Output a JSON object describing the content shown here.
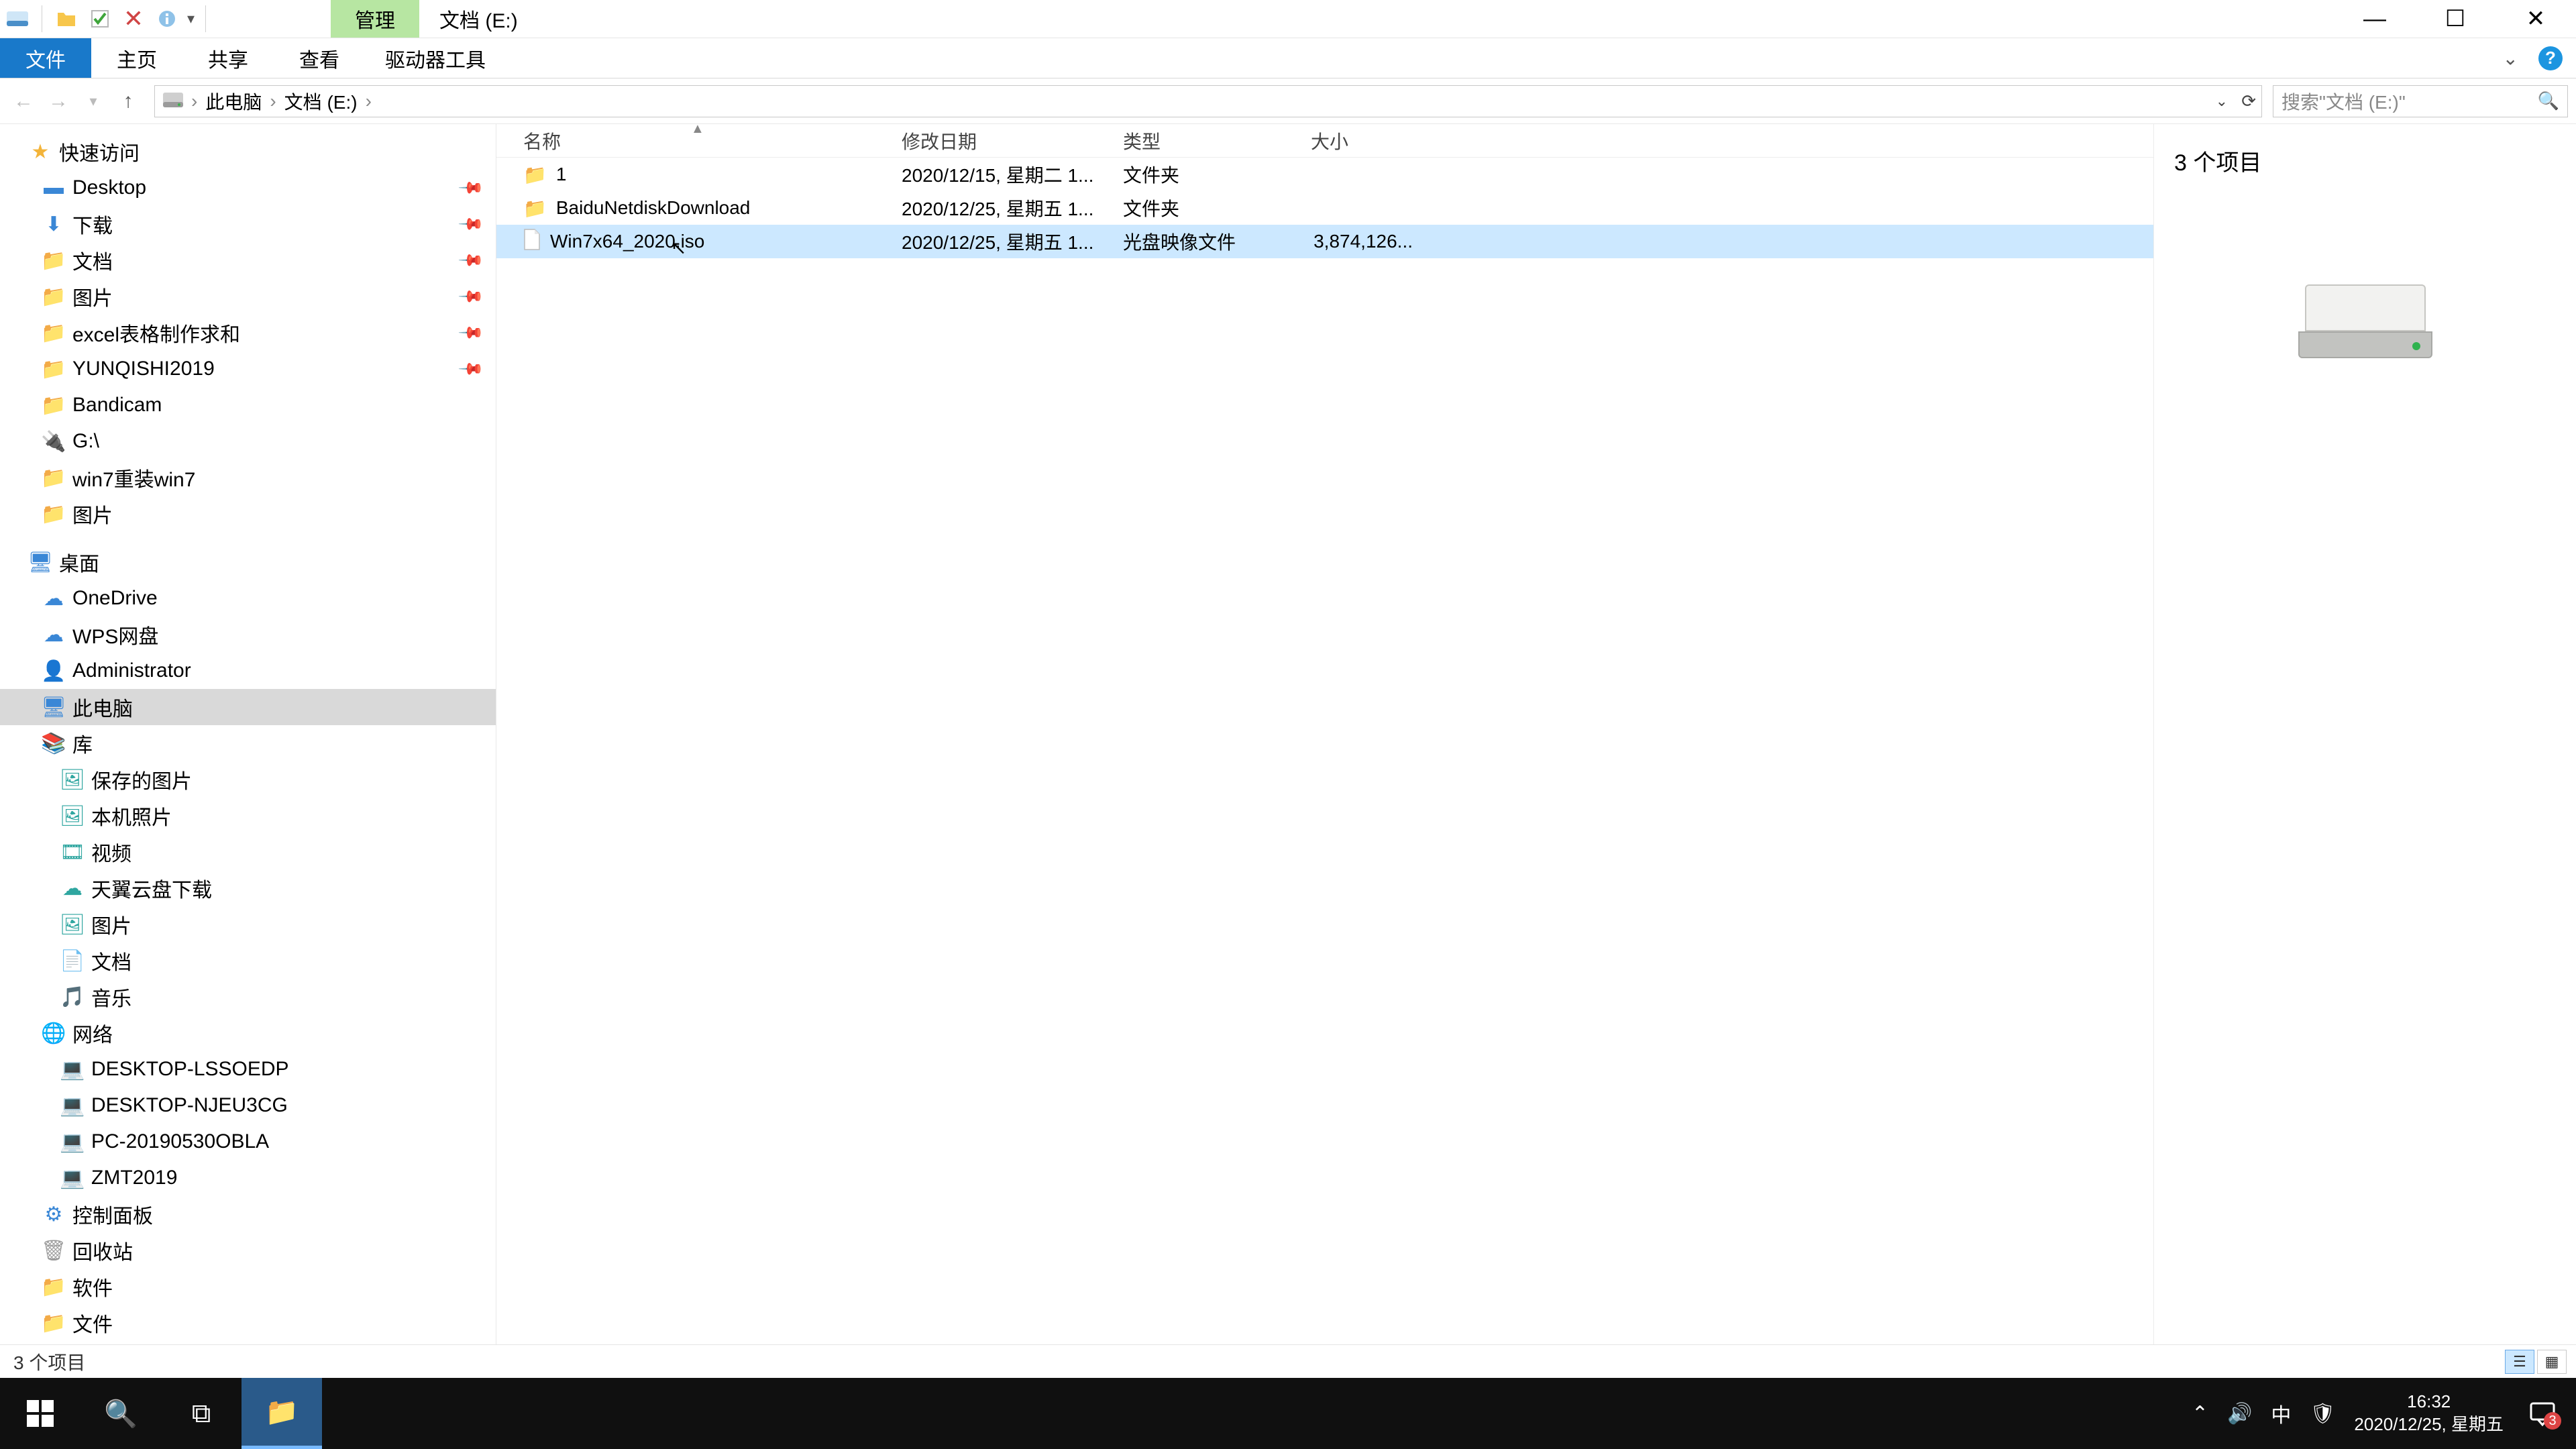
{
  "titlebar": {
    "context_tab": "管理",
    "window_title": "文档 (E:)"
  },
  "ribbon": {
    "file": "文件",
    "home": "主页",
    "share": "共享",
    "view": "查看",
    "drive": "驱动器工具"
  },
  "breadcrumbs": {
    "root": "此电脑",
    "drive": "文档 (E:)"
  },
  "search": {
    "placeholder": "搜索\"文档 (E:)\""
  },
  "tree": {
    "quick_access": "快速访问",
    "desktop": "Desktop",
    "downloads": "下载",
    "documents": "文档",
    "pictures": "图片",
    "excel": "excel表格制作求和",
    "yunqishi": "YUNQISHI2019",
    "bandicam": "Bandicam",
    "gdrive": "G:\\",
    "win7": "win7重装win7",
    "pictures2": "图片",
    "desktop_cn": "桌面",
    "onedrive": "OneDrive",
    "wps": "WPS网盘",
    "admin": "Administrator",
    "this_pc": "此电脑",
    "library": "库",
    "saved_pics": "保存的图片",
    "camera_roll": "本机照片",
    "video": "视频",
    "tianyi": "天翼云盘下载",
    "pictures3": "图片",
    "documents2": "文档",
    "music": "音乐",
    "network": "网络",
    "pc1": "DESKTOP-LSSOEDP",
    "pc2": "DESKTOP-NJEU3CG",
    "pc3": "PC-20190530OBLA",
    "pc4": "ZMT2019",
    "control": "控制面板",
    "recycle": "回收站",
    "software": "软件",
    "files": "文件"
  },
  "columns": {
    "name": "名称",
    "date": "修改日期",
    "type": "类型",
    "size": "大小"
  },
  "rows": [
    {
      "name": "1",
      "date": "2020/12/15, 星期二 1...",
      "type": "文件夹",
      "size": ""
    },
    {
      "name": "BaiduNetdiskDownload",
      "date": "2020/12/25, 星期五 1...",
      "type": "文件夹",
      "size": ""
    },
    {
      "name": "Win7x64_2020.iso",
      "date": "2020/12/25, 星期五 1...",
      "type": "光盘映像文件",
      "size": "3,874,126..."
    }
  ],
  "preview": {
    "count_label": "3 个项目"
  },
  "statusbar": {
    "text": "3 个项目"
  },
  "tray": {
    "ime": "中",
    "time": "16:32",
    "date": "2020/12/25, 星期五",
    "notif_count": "3"
  }
}
